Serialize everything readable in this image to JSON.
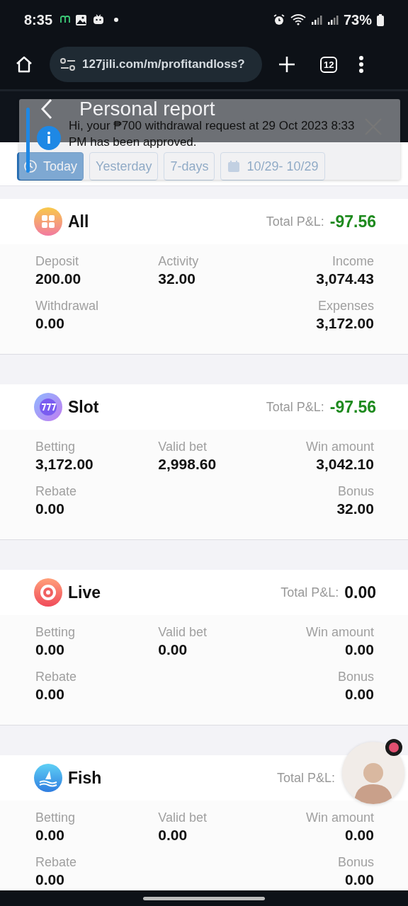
{
  "status_bar": {
    "time": "8:35",
    "battery": "73%"
  },
  "browser": {
    "url": "127jili.com/m/profitandloss?",
    "tab_count": "12"
  },
  "header": {
    "title": "Personal report"
  },
  "filters": [
    {
      "label": "Today",
      "selected": true
    },
    {
      "label": "Yesterday",
      "selected": false
    },
    {
      "label": "7-days",
      "selected": false
    },
    {
      "label": "10/29- 10/29",
      "selected": false
    }
  ],
  "notification": {
    "message": "Hi, your ₱700 withdrawal request at 29 Oct 2023 8:33 PM has been approved."
  },
  "cards": [
    {
      "title": "All",
      "kind": "all",
      "pnl_label": "Total P&L:",
      "pnl_value": "-97.56",
      "color": "#1e8a1e",
      "rows": [
        {
          "left": {
            "label": "Deposit",
            "value": "200.00"
          },
          "middle": {
            "label": "Activity",
            "value": "32.00"
          },
          "right": {
            "label": "Income",
            "value": "3,074.43"
          }
        },
        {
          "left": {
            "label": "Withdrawal",
            "value": "0.00"
          },
          "right": {
            "label": "Expenses",
            "value": "3,172.00"
          }
        }
      ]
    },
    {
      "title": "Slot",
      "kind": "slot",
      "pnl_label": "Total P&L:",
      "pnl_value": "-97.56",
      "color": "#1e8a1e",
      "rows": [
        {
          "left": {
            "label": "Betting",
            "value": "3,172.00"
          },
          "middle": {
            "label": "Valid bet",
            "value": "2,998.60"
          },
          "right": {
            "label": "Win amount",
            "value": "3,042.10"
          }
        },
        {
          "left": {
            "label": "Rebate",
            "value": "0.00"
          },
          "right": {
            "label": "Bonus",
            "value": "32.00"
          }
        }
      ]
    },
    {
      "title": "Live",
      "kind": "live",
      "pnl_label": "Total P&L:",
      "pnl_value": "0.00",
      "color": "#111111",
      "rows": [
        {
          "left": {
            "label": "Betting",
            "value": "0.00"
          },
          "middle": {
            "label": "Valid bet",
            "value": "0.00"
          },
          "right": {
            "label": "Win amount",
            "value": "0.00"
          }
        },
        {
          "left": {
            "label": "Rebate",
            "value": "0.00"
          },
          "right": {
            "label": "Bonus",
            "value": "0.00"
          }
        }
      ]
    },
    {
      "title": "Fish",
      "kind": "fish",
      "pnl_label": "Total P&L:",
      "rows": [
        {
          "left": {
            "label": "Betting",
            "value": "0.00"
          },
          "middle": {
            "label": "Valid bet",
            "value": "0.00"
          },
          "right": {
            "label": "Win amount",
            "value": "0.00"
          }
        },
        {
          "left": {
            "label": "Rebate",
            "value": "0.00"
          },
          "right": {
            "label": "Bonus",
            "value": "0.00"
          }
        }
      ]
    }
  ]
}
